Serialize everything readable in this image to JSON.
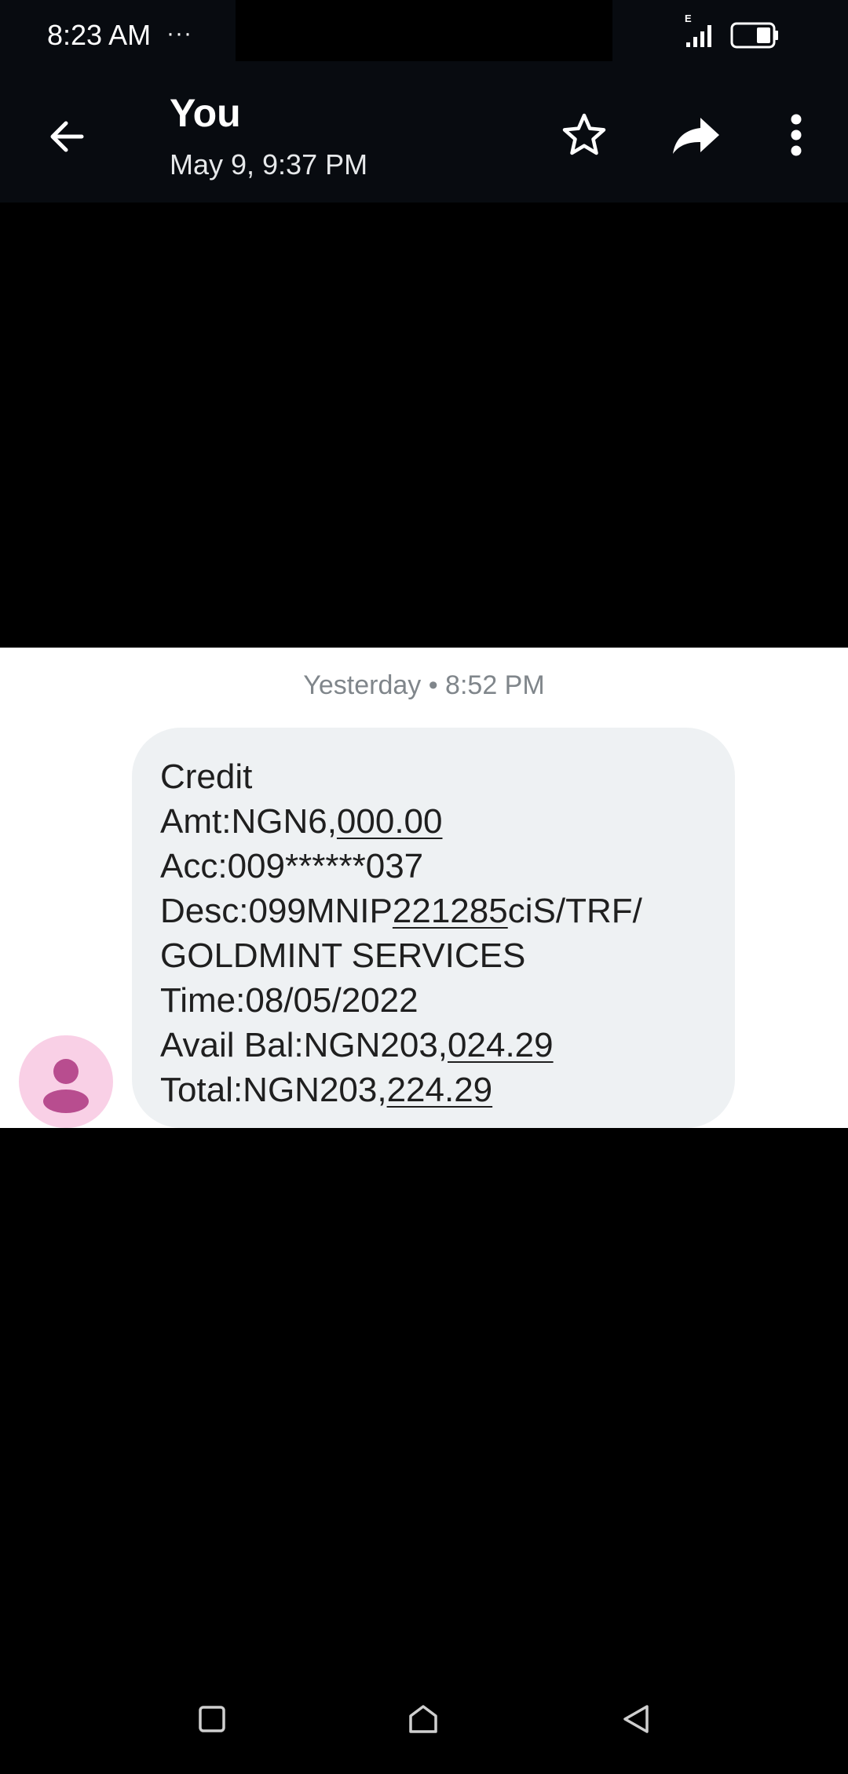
{
  "status_bar": {
    "time": "8:23 AM",
    "notification_dots": "···",
    "network_type": "E",
    "icons": [
      "signal-icon",
      "battery-icon"
    ]
  },
  "header": {
    "title": "You",
    "subtitle": "May 9, 9:37 PM",
    "icons": [
      "back-arrow-icon",
      "star-icon",
      "forward-icon",
      "more-vert-icon"
    ]
  },
  "conversation": {
    "timestamp": "Yesterday • 8:52 PM",
    "message": {
      "line1": "Credit",
      "line2_prefix": "Amt:NGN6,",
      "line2_link": "000.00",
      "line3": "Acc:009******037",
      "line4_prefix": "Desc:099MNIP",
      "line4_link": "221285",
      "line4_suffix": "ciS/TRF/",
      "line5": "GOLDMINT SERVICES",
      "line6": "Time:08/05/2022",
      "line7_prefix": "Avail Bal:NGN203,",
      "line7_link": "024.29",
      "line8_prefix": "Total:NGN203,",
      "line8_link": "224.29"
    },
    "avatar_icon": "person-icon"
  },
  "nav_bar": {
    "icons": [
      "recents-square-icon",
      "home-icon",
      "back-triangle-icon"
    ]
  },
  "colors": {
    "bar_background": "#080b10",
    "bubble_background": "#eef1f3",
    "avatar_background": "#f9d0e6",
    "avatar_figure": "#b84d8f",
    "timestamp_text": "#80868b"
  }
}
